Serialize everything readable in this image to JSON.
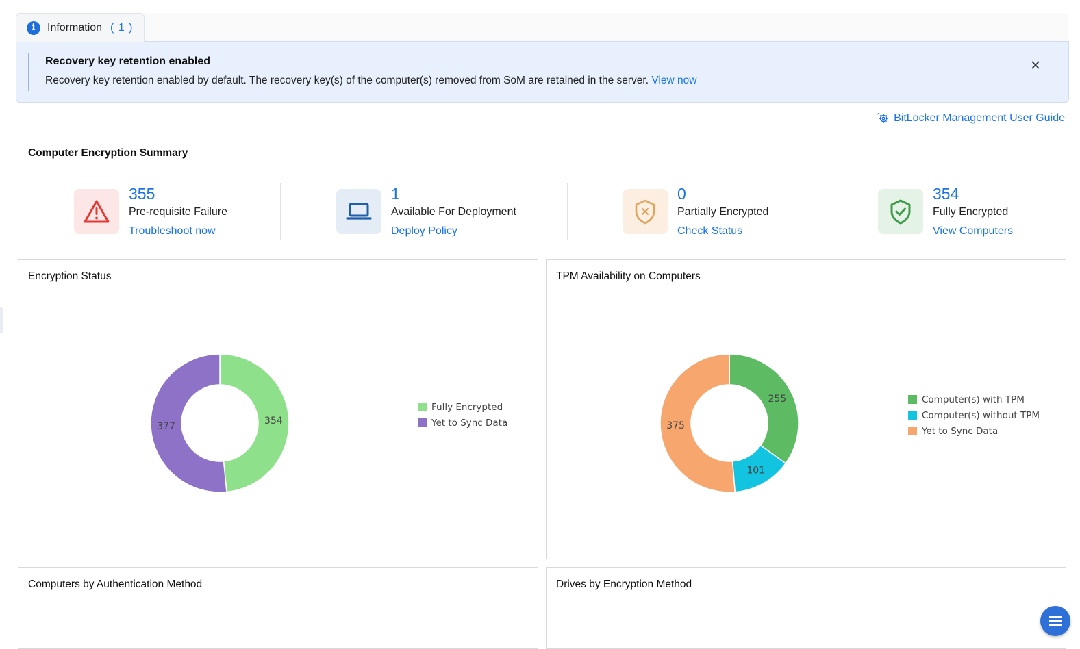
{
  "info_tab": {
    "label": "Information",
    "count": "( 1 )"
  },
  "alert": {
    "title": "Recovery key retention enabled",
    "message": "Recovery key retention enabled by default. The recovery key(s) of the computer(s) removed from SoM are retained in the server.",
    "link": "View now"
  },
  "guide_link": "BitLocker Management User Guide",
  "summary": {
    "title": "Computer Encryption Summary",
    "stats": [
      {
        "value": "355",
        "label": "Pre-requisite Failure",
        "link": "Troubleshoot now",
        "icon": "warning-icon",
        "color": "#e53935",
        "bg": "#fde6e6"
      },
      {
        "value": "1",
        "label": "Available For Deployment",
        "link": "Deploy Policy",
        "icon": "laptop-icon",
        "color": "#1f5fa8",
        "bg": "#e4ecf6"
      },
      {
        "value": "0",
        "label": "Partially Encrypted",
        "link": "Check Status",
        "icon": "shield-x-icon",
        "color": "#e0a35c",
        "bg": "#fcefe2"
      },
      {
        "value": "354",
        "label": "Fully Encrypted",
        "link": "View Computers",
        "icon": "shield-check-icon",
        "color": "#3f9a4a",
        "bg": "#e5f3e6"
      }
    ]
  },
  "encryption_status": {
    "title": "Encryption Status"
  },
  "tpm_availability": {
    "title": "TPM Availability on Computers"
  },
  "auth_method": {
    "title": "Computers by Authentication Method"
  },
  "drives_method": {
    "title": "Drives by Encryption Method"
  },
  "chart_data": [
    {
      "type": "pie",
      "title": "Encryption Status",
      "donut": true,
      "legend_position": "right",
      "series": [
        {
          "name": "Fully Encrypted",
          "value": 354,
          "color": "#8fe08a"
        },
        {
          "name": "Yet to Sync Data",
          "value": 377,
          "color": "#8e72c8"
        }
      ]
    },
    {
      "type": "pie",
      "title": "TPM Availability on Computers",
      "donut": true,
      "legend_position": "right",
      "series": [
        {
          "name": "Computer(s) with TPM",
          "value": 255,
          "color": "#5dbb63"
        },
        {
          "name": "Computer(s) without TPM",
          "value": 101,
          "color": "#13c4e0"
        },
        {
          "name": "Yet to Sync Data",
          "value": 375,
          "color": "#f7a66e"
        }
      ]
    }
  ]
}
